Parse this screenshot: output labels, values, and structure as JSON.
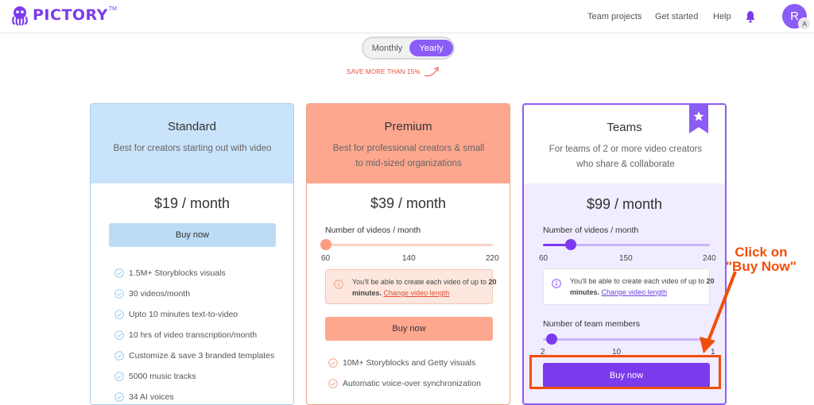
{
  "brand": {
    "name": "PICTORY",
    "tm": "TM"
  },
  "nav": {
    "team_projects": "Team projects",
    "get_started": "Get started",
    "help": "Help"
  },
  "user": {
    "initial": "R",
    "sub_initial": "A"
  },
  "billing": {
    "monthly": "Monthly",
    "yearly": "Yearly",
    "selected": "Yearly",
    "save_note": "SAVE MORE THAN 15%"
  },
  "plans": [
    {
      "name": "Standard",
      "description": "Best for creators starting out with video",
      "price": "$19 / month",
      "button": "Buy now",
      "header_color": "#c9e3fa",
      "features": [
        "1.5M+ Storyblocks visuals",
        "30 videos/month",
        "Upto 10 minutes text-to-video",
        "10 hrs of video transcription/month",
        "Customize & save 3 branded templates",
        "5000 music tracks",
        "34 AI voices"
      ]
    },
    {
      "name": "Premium",
      "description": "Best for professional creators & small to mid-sized organizations",
      "price": "$39 / month",
      "button": "Buy now",
      "header_color": "#fca78e",
      "slider": {
        "label": "Number of videos / month",
        "ticks": [
          "60",
          "140",
          "220"
        ],
        "value": 60
      },
      "info": {
        "text": "You'll be able to create each video of up to ",
        "bold": "20 minutes.",
        "link": "Change video length"
      },
      "features": [
        "10M+ Storyblocks and Getty visuals",
        "Automatic voice-over synchronization"
      ]
    },
    {
      "name": "Teams",
      "description": "For teams of 2 or more video creators who share & collaborate",
      "price": "$99 / month",
      "button": "Buy now",
      "accent_color": "#8b5cf6",
      "slider": {
        "label": "Number of videos / month",
        "ticks": [
          "60",
          "150",
          "240"
        ],
        "value": 60
      },
      "info": {
        "text": "You'll be able to create each video of up to ",
        "bold": "20 minutes.",
        "link": "Change video length"
      },
      "members_slider": {
        "label": "Number of team members",
        "ticks": [
          "2",
          "10",
          "1"
        ],
        "value": 2
      }
    }
  ],
  "annotation": {
    "line1": "Click on",
    "line2": "\"Buy Now\"",
    "color": "#f04e0a"
  }
}
